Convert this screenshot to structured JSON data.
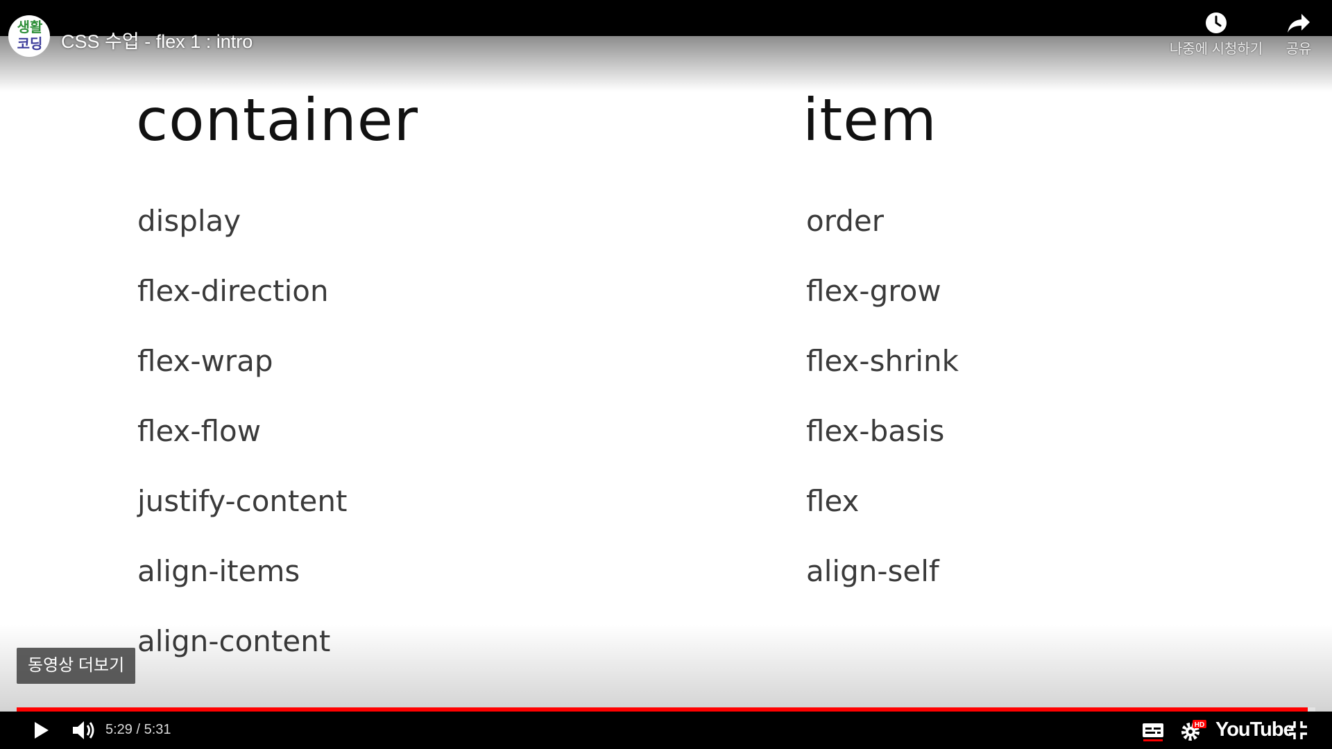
{
  "video": {
    "title": "CSS 수업 - flex 1 : intro",
    "channel_avatar_lines": [
      "생활",
      "코딩"
    ]
  },
  "top_actions": {
    "watch_later_label": "나중에 시청하기",
    "share_label": "공유"
  },
  "slide": {
    "container_title": "container",
    "item_title": "item",
    "container_properties": [
      "display",
      "flex-direction",
      "flex-wrap",
      "flex-flow",
      "justify-content",
      "align-items",
      "align-content"
    ],
    "item_properties": [
      "order",
      "flex-grow",
      "flex-shrink",
      "flex-basis",
      "flex",
      "align-self"
    ]
  },
  "overlay": {
    "more_videos_label": "동영상 더보기"
  },
  "controls": {
    "time": "5:29 / 5:31",
    "progress_fraction": 0.994,
    "brand": "YouTube",
    "hd_badge": "HD",
    "accent_color": "#ff0000"
  },
  "icons": {
    "play": "play-icon",
    "volume": "volume-icon",
    "subtitles": "subtitles-icon",
    "settings": "gear-icon",
    "exit_fullscreen": "exit-fullscreen-icon",
    "watch_later": "clock-icon",
    "share": "share-icon"
  }
}
